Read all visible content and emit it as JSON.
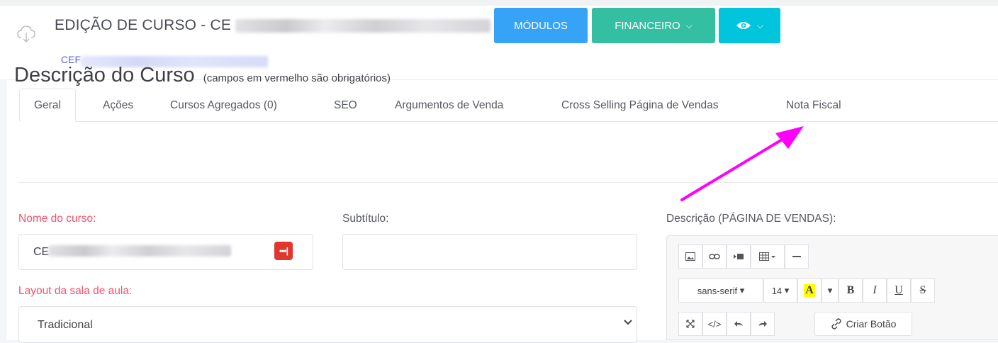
{
  "header": {
    "title": "EDIÇÃO DE CURSO - CE",
    "subcode": "CEF"
  },
  "buttons": {
    "modulos": "MÓDULOS",
    "financeiro": "FINANCEIRO",
    "chevron": "⌵"
  },
  "tabs": [
    {
      "label": "Geral",
      "active": true
    },
    {
      "label": "Ações"
    },
    {
      "label": "Cursos Agregados (0)"
    },
    {
      "label": "SEO"
    },
    {
      "label": "Argumentos de Venda"
    },
    {
      "label": "Cross Selling Página de Vendas"
    },
    {
      "label": "Nota Fiscal"
    }
  ],
  "section": {
    "title": "Descrição do Curso",
    "note": "(campos em vermelho são obrigatórios)"
  },
  "form": {
    "nome_label": "Nome do curso:",
    "nome_value": "CE",
    "subtitulo_label": "Subtítulo:",
    "subtitulo_value": "",
    "layout_label": "Layout da sala de aula:",
    "layout_value": "Tradicional",
    "descricao_label": "Descrição (PÁGINA DE VENDAS):"
  },
  "editor": {
    "font_family": "sans-serif",
    "font_size": "14",
    "bold": "B",
    "italic": "I",
    "underline": "U",
    "strike": "S",
    "color_letter": "A",
    "code": "</>",
    "criar_botao": "Criar Botão"
  },
  "colors": {
    "primary_blue": "#36a3f7",
    "success_green": "#34bfa3",
    "info_cyan": "#00c5dc",
    "required_red": "#f4516c",
    "annotation_magenta": "#ff00ff"
  }
}
